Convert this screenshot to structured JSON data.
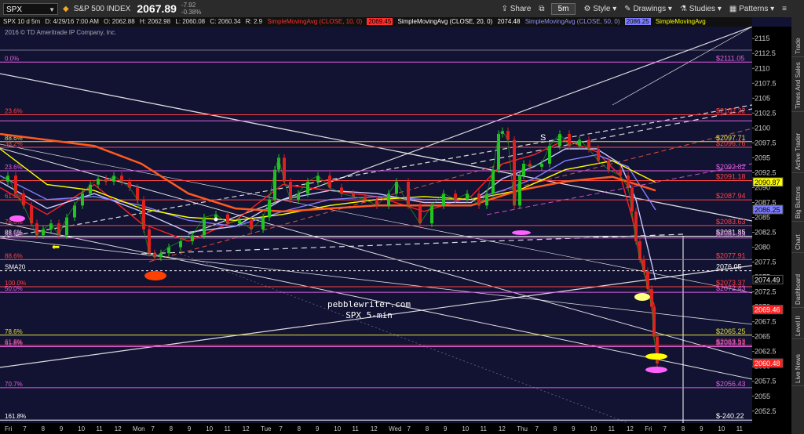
{
  "toolbar": {
    "symbol": "SPX",
    "description": "S&P 500 INDEX",
    "last": "2067.89",
    "change": "-7.92",
    "change_pct": "-0.38%",
    "share": "Share",
    "timeframe": "5m",
    "style": "Style",
    "drawings": "Drawings",
    "studies": "Studies",
    "patterns": "Patterns"
  },
  "info_strip": {
    "period": "SPX 10 d 5m",
    "date": "D: 4/29/16 7:00 AM",
    "open": "O: 2062.88",
    "high": "H: 2062.98",
    "low": "L: 2060.08",
    "close": "C: 2060.34",
    "range": "R: 2.9",
    "sma10_label": "SimpleMovingAvg (CLOSE, 10, 0)",
    "sma10_value": "2069.45",
    "sma20_label": "SimpleMovingAvg (CLOSE, 20, 0)",
    "sma20_value": "2074.48",
    "sma50_label": "SimpleMovingAvg (CLOSE, 50, 0)",
    "sma50_value": "2086.25",
    "sma_extra_label": "SimpleMovingAvg"
  },
  "copyright": "2016 © TD Ameritrade IP Company, Inc.",
  "watermark": [
    "pebblewriter.com",
    "SPX 5-min"
  ],
  "chart_data": {
    "type": "line",
    "ylim": [
      2050.5,
      2117
    ],
    "y_ticks": [
      2115,
      2112.5,
      2110,
      2107.5,
      2105,
      2102.5,
      2100,
      2097.5,
      2095,
      2092.5,
      2090,
      2087.5,
      2085,
      2082.5,
      2080,
      2077.5,
      2075,
      2072.5,
      2070,
      2067.5,
      2065,
      2062.5,
      2060,
      2057.5,
      2055,
      2052.5
    ],
    "x_ticks": [
      "Fri",
      "7",
      "8",
      "9",
      "10",
      "11",
      "12",
      "Mon",
      "7",
      "8",
      "9",
      "10",
      "11",
      "12",
      "Tue",
      "7",
      "8",
      "9",
      "10",
      "11",
      "12",
      "Wed",
      "7",
      "8",
      "9",
      "10",
      "11",
      "12",
      "Thu",
      "7",
      "8",
      "9",
      "10",
      "11",
      "12",
      "Fri",
      "7",
      "8",
      "9",
      "10",
      "11"
    ],
    "price_series": {
      "name": "SPX",
      "x": [
        0,
        10,
        20,
        30,
        40,
        47,
        55,
        65,
        75,
        85,
        95,
        105,
        115,
        125,
        135,
        145,
        155,
        165,
        175,
        183,
        190,
        197,
        205,
        215,
        230,
        245,
        260,
        275,
        290,
        305,
        320,
        335,
        343,
        350,
        355,
        362,
        370,
        380,
        392,
        405,
        420,
        435,
        450,
        465,
        480,
        495,
        505,
        520,
        535,
        550,
        565,
        580,
        595,
        610,
        620,
        628,
        635,
        640,
        647,
        655,
        662,
        667,
        675,
        690,
        700,
        713,
        725,
        738,
        750,
        762,
        775,
        790,
        800,
        805,
        810,
        815,
        820,
        825,
        830,
        833,
        837
      ],
      "y": [
        2091,
        2092,
        2089,
        2087,
        2084,
        2082,
        2083,
        2084,
        2082,
        2085,
        2087,
        2089,
        2090.5,
        2091.5,
        2091,
        2092,
        2091,
        2090,
        2088,
        2083,
        2079,
        2078.3,
        2079,
        2080,
        2081,
        2082,
        2085,
        2085.5,
        2084,
        2084.5,
        2083,
        2085,
        2088,
        2093,
        2095,
        2091,
        2088,
        2089,
        2091,
        2092,
        2090,
        2089,
        2088.5,
        2088,
        2087,
        2089,
        2091,
        2087,
        2084,
        2087,
        2089,
        2088,
        2089,
        2087,
        2089,
        2093,
        2099,
        2099.5,
        2098,
        2087,
        2092,
        2094,
        2093.5,
        2094,
        2097,
        2099,
        2097,
        2098,
        2096.5,
        2094.5,
        2093,
        2092,
        2090,
        2086,
        2081,
        2078,
        2076,
        2073,
        2070,
        2065,
        2060.5
      ]
    },
    "moving_averages": [
      {
        "name": "SimpleMovingAvg (CLOSE, 10, 0)",
        "value": 2069.45,
        "color": "#ff2020",
        "x": [
          0,
          60,
          120,
          180,
          240,
          300,
          360,
          420,
          480,
          540,
          600,
          640,
          680,
          720,
          760,
          790,
          805,
          820,
          835
        ],
        "y": [
          2090,
          2085.5,
          2090.5,
          2084,
          2081,
          2084.5,
          2090.5,
          2089.5,
          2088.5,
          2086,
          2088.5,
          2094,
          2095.5,
          2098,
          2096,
          2092,
          2085,
          2076,
          2069.45
        ]
      },
      {
        "name": "SimpleMovingAvg (CLOSE, 20, 0)",
        "value": 2074.48,
        "color": "#c8c8ff",
        "x": [
          0,
          60,
          120,
          180,
          240,
          300,
          360,
          420,
          480,
          540,
          600,
          640,
          680,
          720,
          760,
          790,
          810,
          835
        ],
        "y": [
          2091,
          2086.5,
          2089,
          2086,
          2082.5,
          2083.5,
          2088,
          2089.5,
          2089,
          2087.5,
          2087.5,
          2091.5,
          2093.5,
          2096.5,
          2096.5,
          2094,
          2088,
          2074.48
        ]
      },
      {
        "name": "SimpleMovingAvg (CLOSE, 50, 0)",
        "value": 2086.25,
        "color": "#8080ff",
        "x": [
          0,
          60,
          120,
          180,
          240,
          300,
          360,
          420,
          480,
          540,
          600,
          640,
          680,
          720,
          760,
          800,
          835
        ],
        "y": [
          2092,
          2088,
          2088.5,
          2087,
          2084.5,
          2083.5,
          2086,
          2088,
          2088.5,
          2088,
          2088,
          2089.5,
          2091.5,
          2094.5,
          2095.5,
          2093.5,
          2086.25
        ]
      },
      {
        "name": "SimpleMovingAvg",
        "value": 2090.87,
        "color": "#ffff00",
        "x": [
          0,
          60,
          120,
          180,
          240,
          300,
          360,
          420,
          480,
          540,
          600,
          660,
          720,
          780,
          835
        ],
        "y": [
          2096.5,
          2090.5,
          2089.5,
          2086.5,
          2085,
          2084.5,
          2085.5,
          2087,
          2088,
          2088.5,
          2088,
          2089.5,
          2093,
          2094.5,
          2090.87
        ]
      },
      {
        "name": "",
        "color": "#ff5a1e",
        "x": [
          0,
          60,
          120,
          180,
          240,
          300,
          360,
          420,
          480,
          540,
          600,
          660,
          720,
          780,
          835
        ],
        "y": [
          2099,
          2098,
          2097,
          2094,
          2089,
          2086.5,
          2086,
          2086.5,
          2087,
          2087,
          2087,
          2089.5,
          2091,
          2091.8,
          2089.5
        ]
      }
    ],
    "hlines": [
      {
        "y": 2111.05,
        "label": "$2111.05",
        "left_label": "0.0%",
        "color": "#e060e0"
      },
      {
        "y": 2102.22,
        "label": "$2102.22",
        "left_label": "23.6%",
        "color": "#ff4444"
      },
      {
        "y": 2101.2,
        "label": "",
        "left_label": "",
        "color": "#e060e0"
      },
      {
        "y": 2097.71,
        "label": "$2097.71",
        "left_label": "88.6%",
        "color": "#e0e040"
      },
      {
        "y": 2096.76,
        "label": "$2096.76",
        "left_label": "38.2%",
        "color": "#ff4444"
      },
      {
        "y": 2092.82,
        "label": "$2092.82",
        "left_label": "23.6%",
        "color": "#e060e0"
      },
      {
        "y": 2091.18,
        "label": "$2091.18",
        "left_label": "",
        "color": "#ff4444"
      },
      {
        "y": 2087.94,
        "label": "$2087.94",
        "left_label": "61.8%",
        "color": "#ff4444"
      },
      {
        "y": 2083.63,
        "label": "$2083.63",
        "left_label": "78.6%",
        "color": "#ff4444"
      },
      {
        "y": 2081.85,
        "label": "$2081.85",
        "left_label": "88.6%",
        "color": "#ffffff"
      },
      {
        "y": 2081.55,
        "label": "$2081.55",
        "left_label": "38.2%",
        "color": "#e060e0"
      },
      {
        "y": 2077.91,
        "label": "$2077.91",
        "left_label": "88.6%",
        "color": "#ff4444"
      },
      {
        "y": 2076.05,
        "label": "2076.05",
        "left_label": "SMA20",
        "color": "#ffffff"
      },
      {
        "y": 2073.37,
        "label": "$2073.37",
        "left_label": "100.0%",
        "color": "#ff4444"
      },
      {
        "y": 2072.43,
        "label": "$2072.43",
        "left_label": "50.0%",
        "color": "#e060e0"
      },
      {
        "y": 2065.25,
        "label": "$2065.25",
        "left_label": "78.6%",
        "color": "#e0e040"
      },
      {
        "y": 2063.53,
        "label": "$2063.53",
        "left_label": "61.8%",
        "color": "#ff4444"
      },
      {
        "y": 2063.31,
        "label": "$2063.31",
        "left_label": "61.8%",
        "color": "#e060e0"
      },
      {
        "y": 2056.43,
        "label": "$2056.43",
        "left_label": "70.7%",
        "color": "#e060e0"
      },
      {
        "y": 2051.0,
        "label": "$-240.22",
        "left_label": "161.8%",
        "color": "#ffffff"
      }
    ],
    "price_badges": [
      {
        "value": "2090.87",
        "color": "#ffff00",
        "text_color": "#000"
      },
      {
        "value": "2086.25",
        "color": "#8080ff",
        "text_color": "#000"
      },
      {
        "value": "2074.49",
        "color": "#000000",
        "text_color": "#fff"
      },
      {
        "value": "2069.46",
        "color": "#ff2020",
        "text_color": "#fff"
      },
      {
        "value": "2060.48",
        "color": "#ff2020",
        "text_color": "#fff"
      }
    ],
    "annotations": [
      "S"
    ],
    "grid": false
  },
  "sidebar": [
    "Trade",
    "Times And Sales",
    "Active Trader",
    "Big Buttons",
    "Chart",
    "Dashboard",
    "Level II",
    "Live News"
  ]
}
